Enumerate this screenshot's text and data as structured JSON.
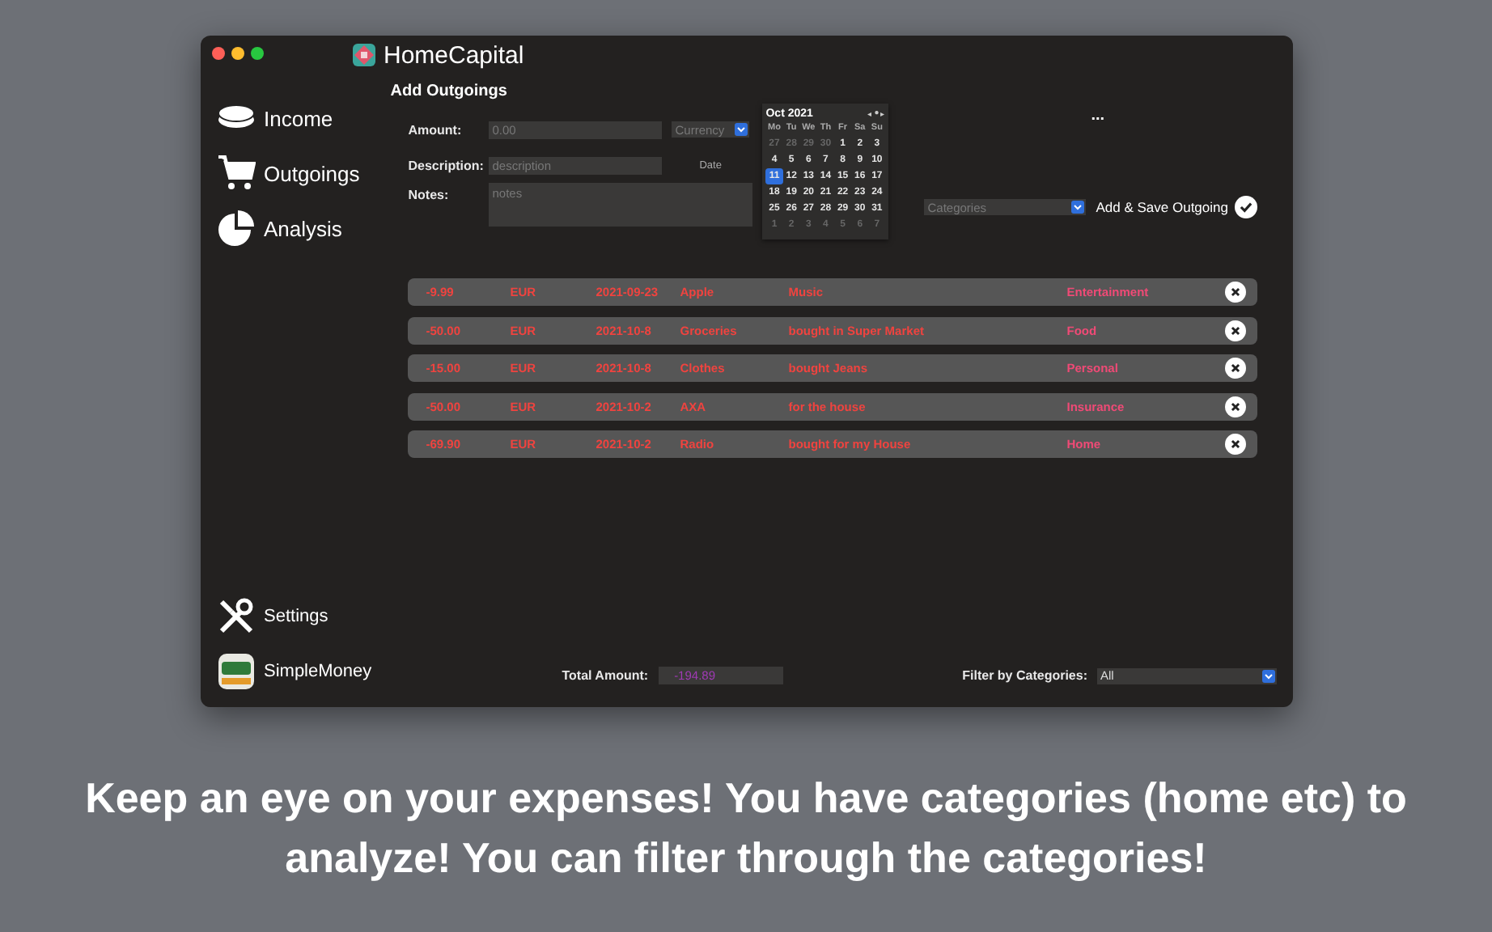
{
  "window": {
    "title": "HomeCapital"
  },
  "sidebar": {
    "items": [
      {
        "label": "Income"
      },
      {
        "label": "Outgoings"
      },
      {
        "label": "Analysis"
      }
    ],
    "bottom_items": [
      {
        "label": "Settings"
      },
      {
        "label": "SimpleMoney"
      }
    ]
  },
  "form": {
    "heading": "Add Outgoings",
    "amount": {
      "label": "Amount:",
      "placeholder": "0.00"
    },
    "currency": {
      "placeholder": "Currency"
    },
    "description": {
      "label": "Description:",
      "placeholder": "description"
    },
    "date_label": "Date",
    "notes": {
      "label": "Notes:",
      "placeholder": "notes"
    },
    "calendar": {
      "month": "Oct 2021",
      "nav": [
        "◂",
        "●",
        "▸"
      ],
      "weekdays": [
        "Mo",
        "Tu",
        "We",
        "Th",
        "Fr",
        "Sa",
        "Su"
      ],
      "weeks": [
        [
          {
            "day": "27",
            "in_month": false,
            "selected": false
          },
          {
            "day": "28",
            "in_month": false,
            "selected": false
          },
          {
            "day": "29",
            "in_month": false,
            "selected": false
          },
          {
            "day": "30",
            "in_month": false,
            "selected": false
          },
          {
            "day": "1",
            "in_month": true,
            "selected": false
          },
          {
            "day": "2",
            "in_month": true,
            "selected": false
          },
          {
            "day": "3",
            "in_month": true,
            "selected": false
          }
        ],
        [
          {
            "day": "4",
            "in_month": true,
            "selected": false
          },
          {
            "day": "5",
            "in_month": true,
            "selected": false
          },
          {
            "day": "6",
            "in_month": true,
            "selected": false
          },
          {
            "day": "7",
            "in_month": true,
            "selected": false
          },
          {
            "day": "8",
            "in_month": true,
            "selected": false
          },
          {
            "day": "9",
            "in_month": true,
            "selected": false
          },
          {
            "day": "10",
            "in_month": true,
            "selected": false
          }
        ],
        [
          {
            "day": "11",
            "in_month": true,
            "selected": true
          },
          {
            "day": "12",
            "in_month": true,
            "selected": false
          },
          {
            "day": "13",
            "in_month": true,
            "selected": false
          },
          {
            "day": "14",
            "in_month": true,
            "selected": false
          },
          {
            "day": "15",
            "in_month": true,
            "selected": false
          },
          {
            "day": "16",
            "in_month": true,
            "selected": false
          },
          {
            "day": "17",
            "in_month": true,
            "selected": false
          }
        ],
        [
          {
            "day": "18",
            "in_month": true,
            "selected": false
          },
          {
            "day": "19",
            "in_month": true,
            "selected": false
          },
          {
            "day": "20",
            "in_month": true,
            "selected": false
          },
          {
            "day": "21",
            "in_month": true,
            "selected": false
          },
          {
            "day": "22",
            "in_month": true,
            "selected": false
          },
          {
            "day": "23",
            "in_month": true,
            "selected": false
          },
          {
            "day": "24",
            "in_month": true,
            "selected": false
          }
        ],
        [
          {
            "day": "25",
            "in_month": true,
            "selected": false
          },
          {
            "day": "26",
            "in_month": true,
            "selected": false
          },
          {
            "day": "27",
            "in_month": true,
            "selected": false
          },
          {
            "day": "28",
            "in_month": true,
            "selected": false
          },
          {
            "day": "29",
            "in_month": true,
            "selected": false
          },
          {
            "day": "30",
            "in_month": true,
            "selected": false
          },
          {
            "day": "31",
            "in_month": true,
            "selected": false
          }
        ],
        [
          {
            "day": "1",
            "in_month": false,
            "selected": false
          },
          {
            "day": "2",
            "in_month": false,
            "selected": false
          },
          {
            "day": "3",
            "in_month": false,
            "selected": false
          },
          {
            "day": "4",
            "in_month": false,
            "selected": false
          },
          {
            "day": "5",
            "in_month": false,
            "selected": false
          },
          {
            "day": "6",
            "in_month": false,
            "selected": false
          },
          {
            "day": "7",
            "in_month": false,
            "selected": false
          }
        ]
      ]
    },
    "more": "...",
    "categories": {
      "placeholder": "Categories"
    },
    "save_button": "Add & Save Outgoing"
  },
  "entries": [
    {
      "amount": "-9.99",
      "currency": "EUR",
      "date": "2021-09-23",
      "name": "Apple",
      "notes": "Music",
      "category": "Entertainment"
    },
    {
      "amount": "-50.00",
      "currency": "EUR",
      "date": "2021-10-8",
      "name": "Groceries",
      "notes": "bought in Super Market",
      "category": "Food"
    },
    {
      "amount": "-15.00",
      "currency": "EUR",
      "date": "2021-10-8",
      "name": "Clothes",
      "notes": "bought Jeans",
      "category": "Personal"
    },
    {
      "amount": "-50.00",
      "currency": "EUR",
      "date": "2021-10-2",
      "name": "AXA",
      "notes": "for the house",
      "category": "Insurance"
    },
    {
      "amount": "-69.90",
      "currency": "EUR",
      "date": "2021-10-2",
      "name": "Radio",
      "notes": "bought for my House",
      "category": "Home"
    }
  ],
  "footer": {
    "total_label": "Total Amount:",
    "total_value": "-194.89",
    "filter_label": "Filter by Categories:",
    "filter_value": "All"
  },
  "caption": "Keep an eye on your expenses! You have categories (home etc) to analyze! You can filter through the categories!"
}
